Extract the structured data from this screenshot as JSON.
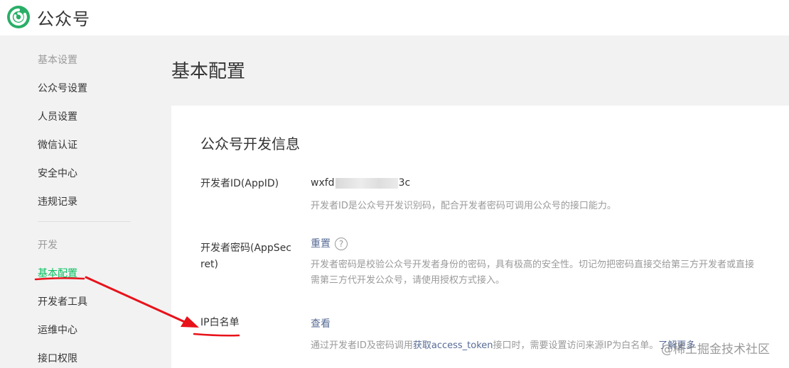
{
  "header": {
    "brand": "公众号"
  },
  "sidebar": {
    "sections": [
      {
        "title": "基本设置",
        "items": [
          "公众号设置",
          "人员设置",
          "微信认证",
          "安全中心",
          "违规记录"
        ]
      },
      {
        "title": "开发",
        "items": [
          "基本配置",
          "开发者工具",
          "运维中心",
          "接口权限"
        ]
      }
    ],
    "active_item": "基本配置"
  },
  "page": {
    "title": "基本配置"
  },
  "panel": {
    "title": "公众号开发信息",
    "appid": {
      "label": "开发者ID(AppID)",
      "value_prefix": "wxfd",
      "value_suffix": "3c",
      "desc": "开发者ID是公众号开发识别码，配合开发者密码可调用公众号的接口能力。"
    },
    "secret": {
      "label_line1": "开发者密码(AppSec",
      "label_line2": "ret)",
      "action": "重置",
      "help": "?",
      "desc_line1": "开发者密码是校验公众号开发者身份的密码，具有极高的安全性。切记勿把密码直接交给第三方开发者或直接",
      "desc_line2": "需第三方代开发公众号，请使用授权方式接入。"
    },
    "ipwhitelist": {
      "label": "IP白名单",
      "action": "查看",
      "desc_prefix": "通过开发者ID及密码调用",
      "desc_link": "获取access_token",
      "desc_middle": "接口时，需要设置访问来源IP为白名单。",
      "desc_more": "了解更多"
    }
  },
  "watermark": "@稀土掘金技术社区",
  "colors": {
    "accent": "#07c160",
    "link": "#576b95",
    "annotation": "#e8121a"
  }
}
